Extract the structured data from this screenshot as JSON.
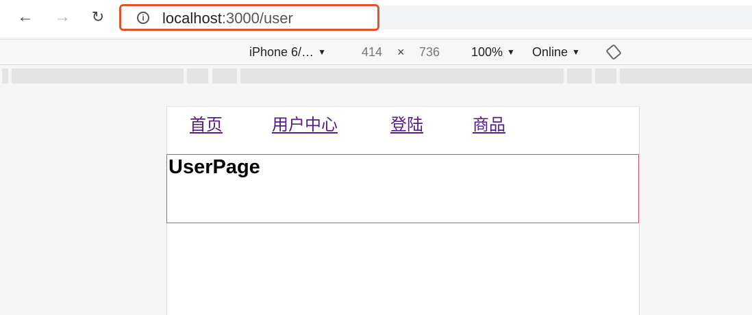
{
  "browser": {
    "url_host": "localhost",
    "url_rest": ":3000/user",
    "info_icon_glyph": "i",
    "highlight_color": "#e0542c",
    "icons": [
      "back-arrow-icon",
      "forward-arrow-icon",
      "reload-icon",
      "info-icon"
    ]
  },
  "device_toolbar": {
    "device": "iPhone 6/…",
    "width": "414",
    "times": "×",
    "height": "736",
    "zoom": "100%",
    "network": "Online",
    "rotate_icon": "rotate-icon"
  },
  "page": {
    "nav": [
      "首页",
      "用户中心",
      "登陆",
      "商品"
    ],
    "title": "UserPage",
    "link_color": "#551a8b",
    "box_border_color": "#c8597a"
  }
}
